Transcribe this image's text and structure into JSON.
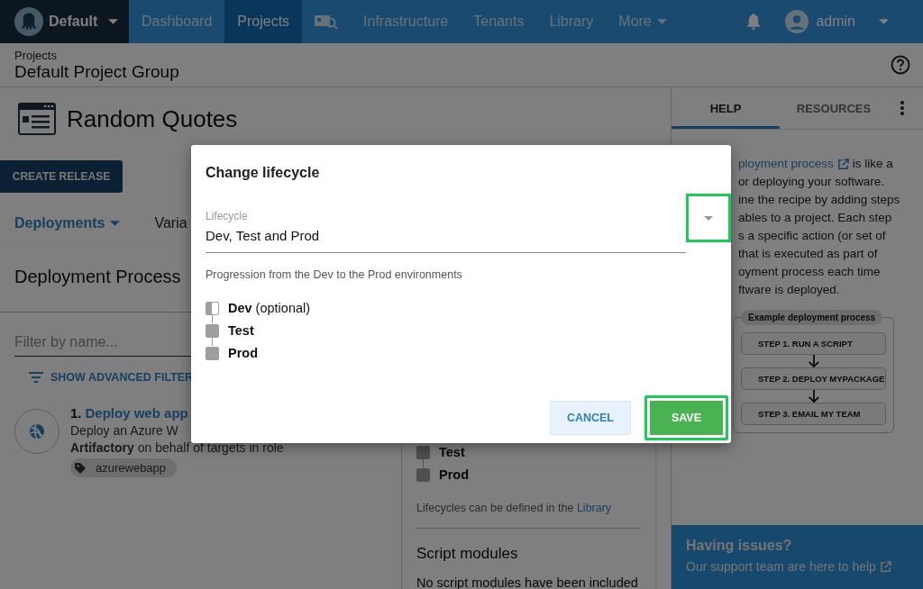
{
  "nav": {
    "space": "Default",
    "items": [
      {
        "label": "Dashboard",
        "kind": "text",
        "selected": false
      },
      {
        "label": "Projects",
        "kind": "text",
        "selected": true
      },
      {
        "kind": "icon",
        "selected": false
      },
      {
        "label": "Infrastructure",
        "kind": "text",
        "selected": false
      },
      {
        "label": "Tenants",
        "kind": "text",
        "selected": false
      },
      {
        "label": "Library",
        "kind": "text",
        "selected": false
      },
      {
        "label": "More",
        "kind": "menu",
        "selected": false
      }
    ],
    "user": "admin"
  },
  "breadcrumb": {
    "parent": "Projects",
    "title": "Default Project Group"
  },
  "project": {
    "name": "Random Quotes",
    "create_release": "CREATE RELEASE",
    "tabs": [
      {
        "label": "Deployments",
        "selected": true
      },
      {
        "label": "Varia",
        "selected": false
      }
    ]
  },
  "process": {
    "title": "Deployment Process",
    "filter_placeholder": "Filter by name...",
    "advanced_filters": "SHOW ADVANCED FILTER",
    "step": {
      "number": "1.",
      "name": "Deploy web app",
      "lines": [
        "Deploy an Azure W",
        "**Artifactory** on behalf of targets in role"
      ],
      "tag": "azurewebapp"
    },
    "phases": [
      {
        "name": "Test",
        "optional": false
      },
      {
        "name": "Prod",
        "optional": false
      }
    ],
    "lifecycle_note": "Lifecycles can be defined in the",
    "lifecycle_link": "Library",
    "modules_title": "Script modules",
    "modules_text": "No script modules have been included"
  },
  "sidebar": {
    "tabs": [
      {
        "label": "HELP",
        "selected": true
      },
      {
        "label": "RESOURCES",
        "selected": false
      }
    ],
    "help_link": "ployment process",
    "help_lines": [
      "is like a",
      "or deploying your software.",
      "ine the recipe by adding steps",
      "ables to a project. Each step",
      "s a specific action (or set of",
      "that is executed as part of",
      "oyment process each time",
      "ftware is deployed."
    ],
    "example_title": "Example deployment process",
    "example_steps": [
      "STEP 1. RUN A SCRIPT",
      "STEP 2. DEPLOY MYPACKAGE",
      "STEP 3. EMAIL MY TEAM"
    ],
    "issues_title": "Having issues?",
    "issues_text": "Our support team are here to help"
  },
  "dialog": {
    "title": "Change lifecycle",
    "field_label": "Lifecycle",
    "field_value": "Dev, Test and Prod",
    "dropdown_highlighted": true,
    "description": "Progression from the Dev to the Prod environments",
    "phases": [
      {
        "name": "Dev",
        "note": "(optional)",
        "optional": true
      },
      {
        "name": "Test",
        "optional": false
      },
      {
        "name": "Prod",
        "optional": false
      }
    ],
    "buttons": [
      {
        "label": "CANCEL",
        "kind": "secondary",
        "highlighted": false
      },
      {
        "label": "SAVE",
        "kind": "primary",
        "highlighted": true
      }
    ]
  }
}
